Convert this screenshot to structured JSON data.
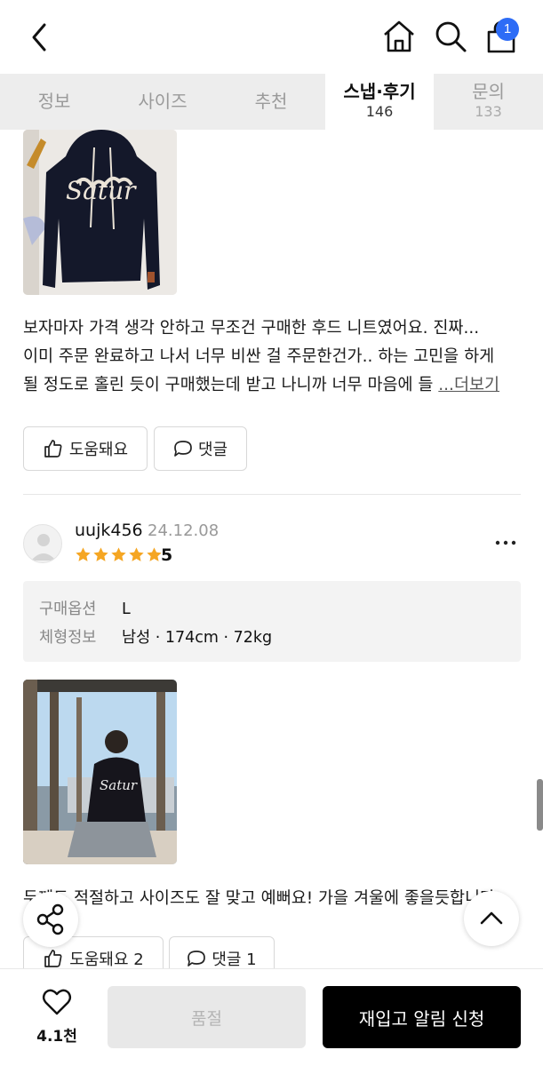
{
  "header": {
    "cart_count": "1",
    "icons": [
      "chevron-left-icon",
      "home-icon",
      "search-icon",
      "shopping-bag-icon"
    ]
  },
  "tabs": [
    {
      "label": "정보",
      "count": ""
    },
    {
      "label": "사이즈",
      "count": ""
    },
    {
      "label": "추천",
      "count": ""
    },
    {
      "label": "스냅·후기",
      "count": "146",
      "active": true
    },
    {
      "label": "문의",
      "count": "133"
    }
  ],
  "review1": {
    "text_lines": [
      "보자마자 가격 생각 안하고 무조건 구매한 후드 니트였어요. 진짜...",
      "이미 주문 완료하고 나서 너무 비싼 걸 주문한건가.. 하는 고민을 하게",
      "될 정도로 홀린 듯이 구매했는데 받고 나니까 너무 마음에 들 "
    ],
    "more_label": "...더보기",
    "helpful_label": "도움돼요",
    "comment_label": "댓글"
  },
  "review2": {
    "username": "uujk456",
    "date": "24.12.08",
    "rating": "5",
    "stars": 5,
    "star_color": "#f5a623",
    "option_key": "구매옵션",
    "option_value": "L",
    "body_key": "체형정보",
    "body_value": "남성 · 174cm · 72kg",
    "text": "두께도 적절하고 사이즈도 잘 맞고 예뻐요! 가을 겨울에 좋을듯합니다",
    "helpful_label": "도움돼요 2",
    "comment_label": "댓글 1"
  },
  "bottom": {
    "like_count": "4.1천",
    "soldout_label": "품절",
    "restock_label": "재입고 알림 신청"
  },
  "colors": {
    "accent_blue": "#2d6cf6",
    "primary_button": "#000000"
  }
}
